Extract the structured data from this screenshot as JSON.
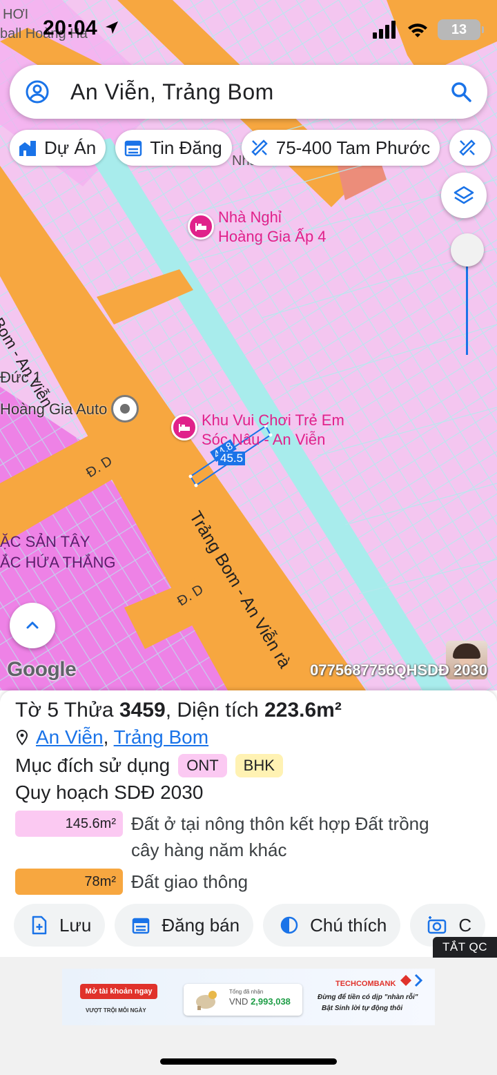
{
  "status": {
    "time": "20:04",
    "battery": "13",
    "map_corner_text_1": "HƠI",
    "map_corner_text_2": "ball Hoàng Hà"
  },
  "search": {
    "text": "An Viễn, Trảng Bom",
    "profile_icon": "person-circle-icon",
    "search_icon": "search-icon"
  },
  "chips": [
    {
      "label": "Dự Án",
      "icon": "building-icon"
    },
    {
      "label": "Tin Đăng",
      "icon": "calendar-icon"
    },
    {
      "label": "75-400 Tam Phước",
      "icon": "ruler-pencil-icon"
    }
  ],
  "map": {
    "labels": {
      "road_tb_av_left": "ng Bom - An Viễn",
      "road_tb_av_main": "Trảng Bom - An Viễn rà",
      "duc": "Đức 1",
      "hoang_gia_auto": "Hoàng Gia Auto",
      "dd1": "Đ. D",
      "dd2": "Đ. D",
      "dac_san_1": "ẶC SẢN TÂY",
      "dac_san_2": "ẮC HỨA THẮNG",
      "nha_nghi_1": "Nhà Nghỉ",
      "nha_nghi_2": "Hoàng Gia Ấp 4",
      "khu_vui_choi_1": "Khu Vui Chơi Trẻ Em",
      "khu_vui_choi_2": "Sóc Nâu - An Viễn",
      "nha_partial": "Nhà",
      "dim_short": "44.8",
      "dim_long": "45.5"
    },
    "google_logo": "Google",
    "watermark": "0775687756QHSDĐ 2030"
  },
  "parcel": {
    "to_label": "Tờ 5 Thửa ",
    "thua_number": "3459",
    "area_label": ", Diện tích ",
    "area_value": "223.6m²",
    "location_ward": "An Viễn",
    "location_sep": ",",
    "location_district": "Trảng Bom",
    "purpose_label": "Mục đích sử dụng",
    "purpose_tags": [
      "ONT",
      "BHK"
    ],
    "plan_title": "Quy hoạch SDĐ 2030",
    "zones": [
      {
        "area": "145.6m²",
        "text_line1": "Đất ở tại nông thôn kết hợp Đất trồng",
        "text_line2": "cây hàng năm khác",
        "color": "#fbc9f2"
      },
      {
        "area": "78m²",
        "text_line1": "Đất giao thông",
        "text_line2": "",
        "color": "#f7a740"
      }
    ]
  },
  "actions": [
    {
      "label": "Lưu",
      "icon": "save-doc-icon"
    },
    {
      "label": "Đăng bán",
      "icon": "calendar-list-icon"
    },
    {
      "label": "Chú thích",
      "icon": "half-circle-icon"
    },
    {
      "label": "C",
      "icon": "camera-icon"
    }
  ],
  "ad": {
    "close_label": "TẮT QC",
    "cta": "Mở tài khoản ngay",
    "sub": "VƯỢT TRỘI MỖI NGÀY",
    "card_line1": "Tổng đã nhận",
    "card_currency": "VND",
    "card_amount": "2,993,038",
    "bank": "TECHCOMBANK",
    "tagline1": "Đừng để tiền có dịp \"nhàn rỗi\"",
    "tagline2": "Bật Sinh lời tự động thôi"
  },
  "colors": {
    "map_residential": "#f4c6f0",
    "map_road": "#f7a740",
    "map_water": "#a8ecec",
    "poi": "#e0218a",
    "link": "#1a73e8"
  }
}
